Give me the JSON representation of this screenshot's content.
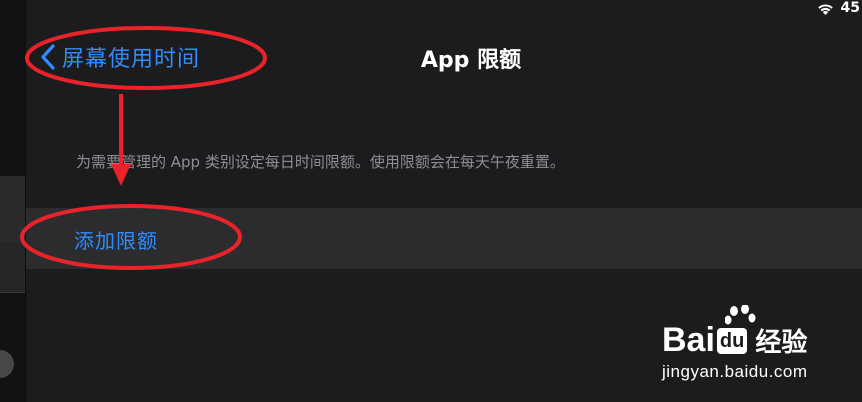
{
  "status_bar": {
    "battery": "45",
    "wifi_icon": "wifi-icon"
  },
  "nav": {
    "back_label": "屏幕使用时间",
    "back_icon": "chevron-left-icon",
    "title": "App 限额"
  },
  "description": "为需要管理的 App 类别设定每日时间限额。使用限额会在每天午夜重置。",
  "add_limit_label": "添加限额",
  "watermark": {
    "brand_prefix": "Bai",
    "brand_du": "du",
    "brand_suffix": "经验",
    "url": "jingyan.baidu.com"
  },
  "colors": {
    "background": "#1c1c1e",
    "row": "#2c2c2e",
    "accent": "#2f8cff",
    "annotation": "#e8232a"
  }
}
